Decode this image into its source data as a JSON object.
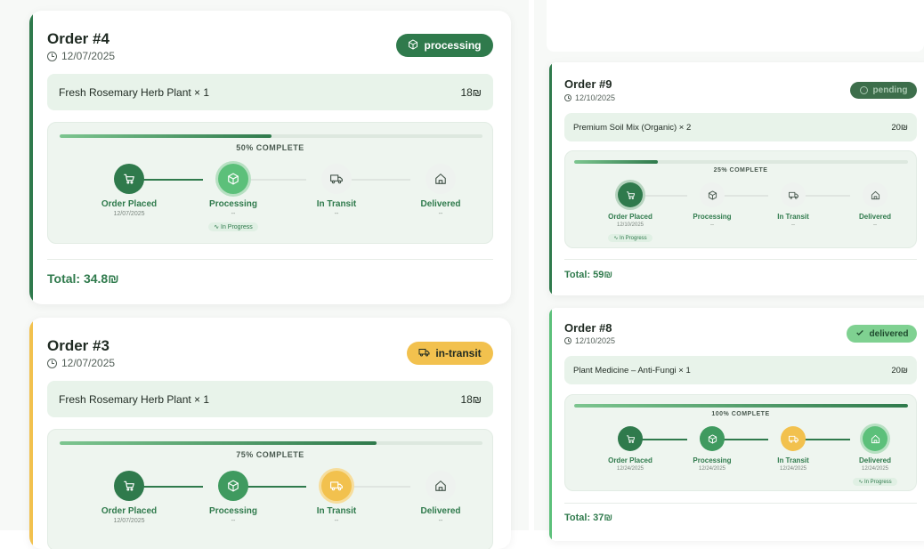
{
  "colors": {
    "brand_dark": "#2f7a4c",
    "brand_light": "#5cc07a",
    "in_transit": "#f2c14e",
    "gray_step": "#eef2ef"
  },
  "orders": [
    {
      "title": "Order #4",
      "date": "12/07/2025",
      "status": "processing",
      "status_icon": "box-icon",
      "item": "Fresh Rosemary Herb Plant × 1",
      "price": "18₪",
      "progress": 0.5,
      "progress_text": "50% COMPLETE",
      "total": "Total: 34.8₪",
      "steps": [
        {
          "label": "Order Placed",
          "date": "12/07/2025",
          "icon": "cart-icon",
          "state": "done"
        },
        {
          "label": "Processing",
          "date": "--",
          "icon": "box-icon",
          "state": "current",
          "pill": "In Progress"
        },
        {
          "label": "In Transit",
          "date": "--",
          "icon": "truck-icon",
          "state": "todo"
        },
        {
          "label": "Delivered",
          "date": "--",
          "icon": "home-icon",
          "state": "todo"
        }
      ]
    },
    {
      "title": "Order #3",
      "date": "12/07/2025",
      "status": "in-transit",
      "status_icon": "truck-icon",
      "item": "Fresh Rosemary Herb Plant × 1",
      "price": "18₪",
      "progress": 0.75,
      "progress_text": "75% COMPLETE",
      "steps": [
        {
          "label": "Order Placed",
          "date": "12/07/2025",
          "icon": "cart-icon",
          "state": "done"
        },
        {
          "label": "Processing",
          "date": "--",
          "icon": "box-icon",
          "state": "done2"
        },
        {
          "label": "In Transit",
          "date": "--",
          "icon": "truck-icon",
          "state": "current-yellow"
        },
        {
          "label": "Delivered",
          "date": "--",
          "icon": "home-icon",
          "state": "todo"
        }
      ]
    },
    {
      "title": "Order #9",
      "date": "12/10/2025",
      "status": "pending",
      "status_icon": "clock-icon",
      "item": "Premium Soil Mix (Organic) × 2",
      "price": "20₪",
      "progress": 0.25,
      "progress_text": "25% COMPLETE",
      "total": "Total: 59₪",
      "steps": [
        {
          "label": "Order Placed",
          "date": "12/10/2025",
          "icon": "cart-icon",
          "state": "current-dark",
          "pill": "In Progress"
        },
        {
          "label": "Processing",
          "date": "--",
          "icon": "box-icon",
          "state": "todo"
        },
        {
          "label": "In Transit",
          "date": "--",
          "icon": "truck-icon",
          "state": "todo"
        },
        {
          "label": "Delivered",
          "date": "--",
          "icon": "home-icon",
          "state": "todo"
        }
      ]
    },
    {
      "title": "Order #8",
      "date": "12/10/2025",
      "status": "delivered",
      "status_icon": "check-icon",
      "item": "Plant Medicine – Anti-Fungi × 1",
      "price": "20₪",
      "progress": 1.0,
      "progress_text": "100% COMPLETE",
      "total": "Total: 37₪",
      "steps": [
        {
          "label": "Order Placed",
          "date": "12/24/2025",
          "icon": "cart-icon",
          "state": "done"
        },
        {
          "label": "Processing",
          "date": "12/24/2025",
          "icon": "box-icon",
          "state": "done2"
        },
        {
          "label": "In Transit",
          "date": "12/24/2025",
          "icon": "truck-icon",
          "state": "done-yellow"
        },
        {
          "label": "Delivered",
          "date": "12/24/2025",
          "icon": "home-icon",
          "state": "current",
          "pill": "In Progress"
        }
      ]
    }
  ]
}
